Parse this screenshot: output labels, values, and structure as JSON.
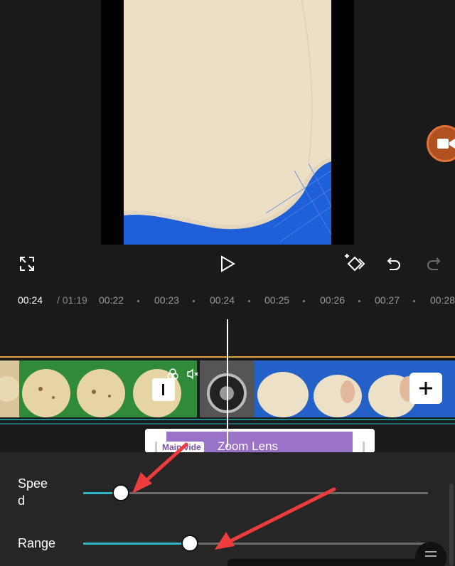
{
  "ruler": {
    "current_time": "00:24",
    "duration": "/ 01:19",
    "ticks": [
      "00:22",
      "00:23",
      "00:24",
      "00:25",
      "00:26",
      "00:27",
      "00:28"
    ]
  },
  "effect_track": {
    "tag": "Main vide",
    "name": "Zoom Lens"
  },
  "adjust_panel": {
    "speed_label": "Spee\nd",
    "speed_value": 0.11,
    "range_label": "Range",
    "range_value": 0.31
  },
  "colors": {
    "accent_cyan": "#2fb7c8",
    "clip_border": "#e6a23c",
    "effect_purple": "#9a72c7",
    "record_orange": "#b0521f",
    "annotation_red": "#ec3c3c"
  },
  "icons": {
    "fullscreen": "fullscreen-icon",
    "play": "play-icon",
    "keyframe": "keyframe-icon",
    "undo": "undo-icon",
    "redo": "redo-icon",
    "record": "record-video-icon",
    "transition": "transition-icon",
    "add": "add-icon"
  }
}
